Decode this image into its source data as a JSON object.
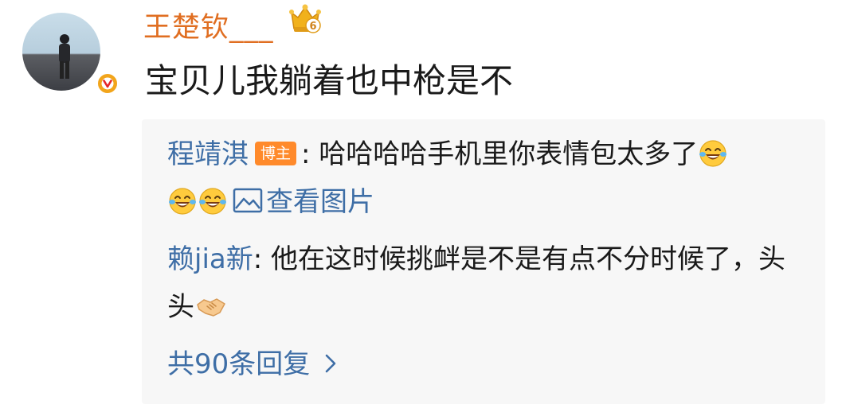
{
  "comment": {
    "username": "王楚钦___",
    "text": "宝贝儿我躺着也中枪是不",
    "avatar_icon": "user-avatar",
    "badge_icon": "verified-v-icon",
    "level_icon": "crown-level-icon",
    "level_number": "6"
  },
  "replies": [
    {
      "name": "程靖淇",
      "badge": "博主",
      "text": ": 哈哈哈哈手机里你表情包太多了",
      "emojis": [
        "laugh-cry-icon",
        "laugh-cry-icon",
        "laugh-cry-icon"
      ],
      "image_link": "查看图片"
    },
    {
      "name": "赖jia新",
      "text": ": 他在这时候挑衅是不是有点不分时候了，头头",
      "emoji": "handshake-icon"
    }
  ],
  "more_replies_label": "共90条回复",
  "colors": {
    "username": "#e06e21",
    "link": "#3e6ea6",
    "badge": "#ff8a2b",
    "reply_bg": "#f7f7f7"
  }
}
